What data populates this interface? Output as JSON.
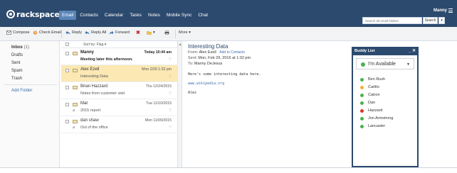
{
  "brand": {
    "name": "rackspace"
  },
  "nav": {
    "items": [
      "Email",
      "Contacts",
      "Calendar",
      "Tasks",
      "Notes",
      "Mobile Sync",
      "Chat"
    ],
    "active": "Email"
  },
  "user": {
    "name": "Manny"
  },
  "search": {
    "placeholder": "Search all email folders",
    "button": "Search"
  },
  "toolbar": {
    "compose": "Compose",
    "check_email": "Check Email",
    "reply": "Reply",
    "reply_all": "Reply All",
    "forward": "Forward",
    "more": "More"
  },
  "folders": {
    "items": [
      {
        "name": "Inbox",
        "count": "(1)"
      },
      {
        "name": "Drafts"
      },
      {
        "name": "Sent"
      },
      {
        "name": "Spam"
      },
      {
        "name": "Trash"
      }
    ],
    "add_folder": "Add Folder"
  },
  "message_list": {
    "sort_label": "Sort by: Flag ▾",
    "rows": [
      {
        "from": "Manny",
        "date": "Today 10:44 am",
        "subject": "Meeting later this afternoon.",
        "unread": true
      },
      {
        "from": "Alex Ezell",
        "date": "Mon 2/29 1:32 pm",
        "subject": "Interesting Data",
        "selected": true
      },
      {
        "from": "Brian Hazzard",
        "date": "Thu 12/24/2015",
        "subject": "Notes from customer visit"
      },
      {
        "from": "Mat",
        "date": "Tue 11/10/2015",
        "subject": "2015 report"
      },
      {
        "from": "dan shaw",
        "date": "Mon 11/09/2015",
        "subject": "Out of the office"
      }
    ]
  },
  "reader": {
    "subject": "Interesting Data",
    "from_label": "From:",
    "from": "Alex Ezell",
    "add_contacts": "Add to Contacts",
    "sent_label": "Sent:",
    "sent": "Mon, Feb 29, 2016 at 1:32 pm",
    "to_label": "To:",
    "to": "Manny DeJesus",
    "body_line1": "Here's some interesting data here.",
    "body_link": "www.wikipedia.org",
    "signature": "Alex"
  },
  "buddy_list": {
    "title": "Buddy List",
    "controls": "_ ✕",
    "status": "I'm Available",
    "buddies": [
      {
        "name": "Ben Rush",
        "status_color": "#4caf50"
      },
      {
        "name": "Carlito",
        "status_color": "#f0b429"
      },
      {
        "name": "Catron",
        "status_color": "#4caf50"
      },
      {
        "name": "Dan",
        "status_color": "#4caf50"
      },
      {
        "name": "Hazzard",
        "status_color": "#d9382c"
      },
      {
        "name": "Jon Armstrong",
        "status_color": "#4caf50"
      },
      {
        "name": "Lancaster",
        "status_color": "#4caf50"
      }
    ]
  },
  "colors": {
    "header": "#2c4a6e",
    "nav_active": "#5b86b7",
    "selected_row": "#fbe8b3",
    "link": "#3a6fb0"
  }
}
